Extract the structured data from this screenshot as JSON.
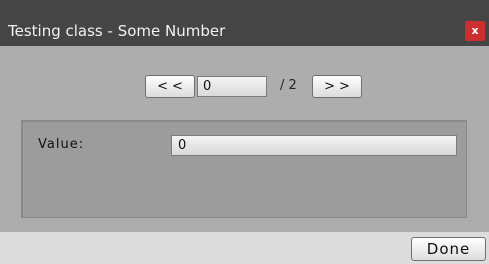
{
  "window": {
    "title": "Testing class - Some Number",
    "close_glyph": "x",
    "close_icon": "close-icon",
    "accent_color": "#cc2f2f"
  },
  "pager": {
    "prev_label": "<<",
    "next_label": ">>",
    "current_page": "0",
    "total_label": "/ 2"
  },
  "form": {
    "value_label": "Value:",
    "value": "0"
  },
  "footer": {
    "done_label": "Done"
  }
}
